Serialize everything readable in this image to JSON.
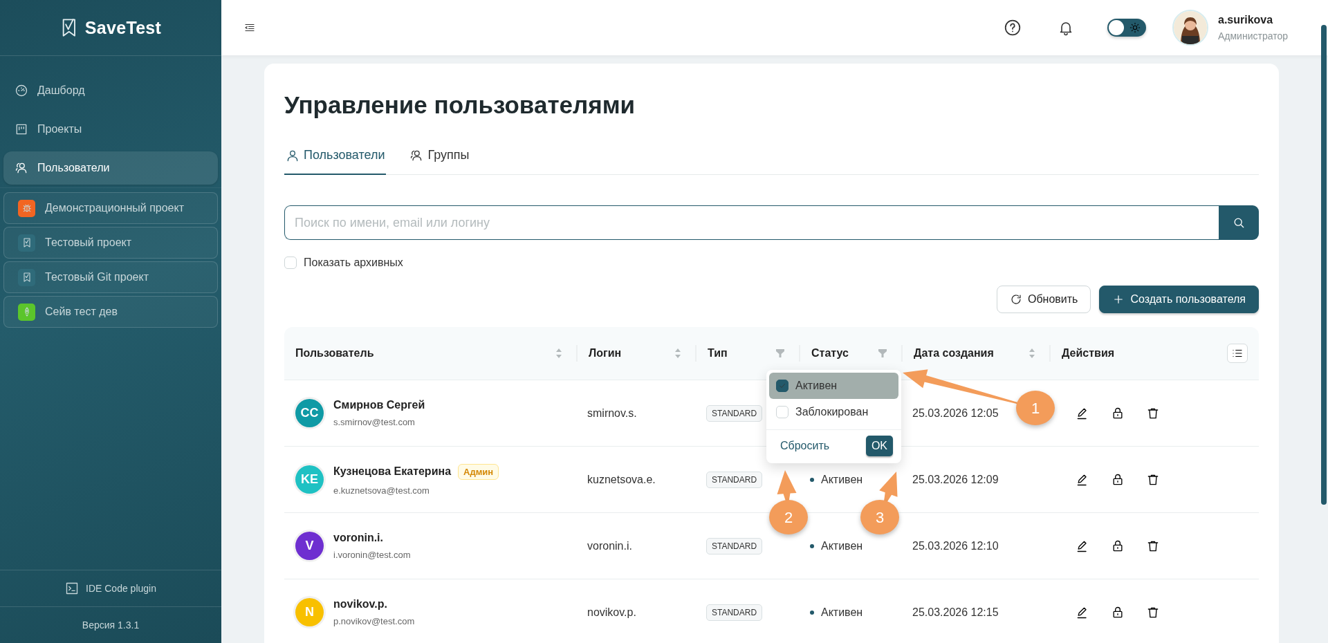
{
  "sidebar": {
    "logo": "SaveTest",
    "nav": [
      {
        "label": "Дашборд",
        "selected": false
      },
      {
        "label": "Проекты",
        "selected": false
      },
      {
        "label": "Пользователи",
        "selected": true
      }
    ],
    "projects": [
      {
        "name": "Демонстрационный проект",
        "kind": "bug",
        "color": "#f26522"
      },
      {
        "name": "Тестовый проект",
        "kind": "check",
        "color": "#2f6b7a"
      },
      {
        "name": "Тестовый Git проект",
        "kind": "check",
        "color": "#2f6b7a"
      },
      {
        "name": "Сейв тест дев",
        "kind": "rocket",
        "color": "#5bc52b"
      }
    ],
    "plugin": "IDE Code plugin",
    "version": "Версия 1.3.1"
  },
  "header": {
    "theme_toggle": {
      "on": false
    },
    "user": {
      "name": "a.surikova",
      "role": "Администратор"
    }
  },
  "page": {
    "title": "Управление пользователями",
    "tabs": [
      {
        "label": "Пользователи",
        "selected": true
      },
      {
        "label": "Группы",
        "selected": false
      }
    ],
    "search": {
      "placeholder": "Поиск по имени, email или логину"
    },
    "show_archived": {
      "label": "Показать архивных",
      "checked": false
    },
    "buttons": [
      {
        "kind": "refresh",
        "label": "Обновить"
      },
      {
        "kind": "create",
        "label": "Создать пользователя"
      }
    ]
  },
  "table": {
    "columns": [
      {
        "label": "Пользователь",
        "kind": "sort"
      },
      {
        "label": "Логин",
        "kind": "sort"
      },
      {
        "label": "Тип",
        "kind": "filter"
      },
      {
        "label": "Статус",
        "kind": "filter"
      },
      {
        "label": "Дата создания",
        "kind": "sort"
      },
      {
        "label": "Действия",
        "kind": "plain"
      }
    ],
    "rows": [
      {
        "initials": "CC",
        "color": "#0f9aa5",
        "name": "Смирнов Сергей",
        "email": "s.smirnov@test.com",
        "login": "smirnov.s.",
        "type": "STANDARD",
        "created": "25.03.2026 12:05"
      },
      {
        "initials": "KE",
        "color": "#1fc1c3",
        "name": "Кузнецова Екатерина",
        "badge": "Админ",
        "email": "e.kuznetsova@test.com",
        "login": "kuznetsova.e.",
        "type": "STANDARD",
        "status": "Активен",
        "created": "25.03.2026 12:09"
      },
      {
        "initials": "V",
        "color": "#6e2fd0",
        "name": "voronin.i.",
        "email": "i.voronin@test.com",
        "login": "voronin.i.",
        "type": "STANDARD",
        "status": "Активен",
        "created": "25.03.2026 12:10"
      },
      {
        "initials": "N",
        "color": "#f8c000",
        "name": "novikov.p.",
        "email": "p.novikov@test.com",
        "login": "novikov.p.",
        "type": "STANDARD",
        "status": "Активен",
        "created": "25.03.2026 12:15"
      }
    ]
  },
  "filter_popup": {
    "options": [
      {
        "label": "Активен",
        "checked": true,
        "selected": true
      },
      {
        "label": "Заблокирован",
        "checked": false,
        "selected": false
      }
    ],
    "reset": "Сбросить",
    "ok": "OK"
  },
  "annotations": [
    {
      "label": "1"
    },
    {
      "label": "2"
    },
    {
      "label": "3"
    }
  ]
}
